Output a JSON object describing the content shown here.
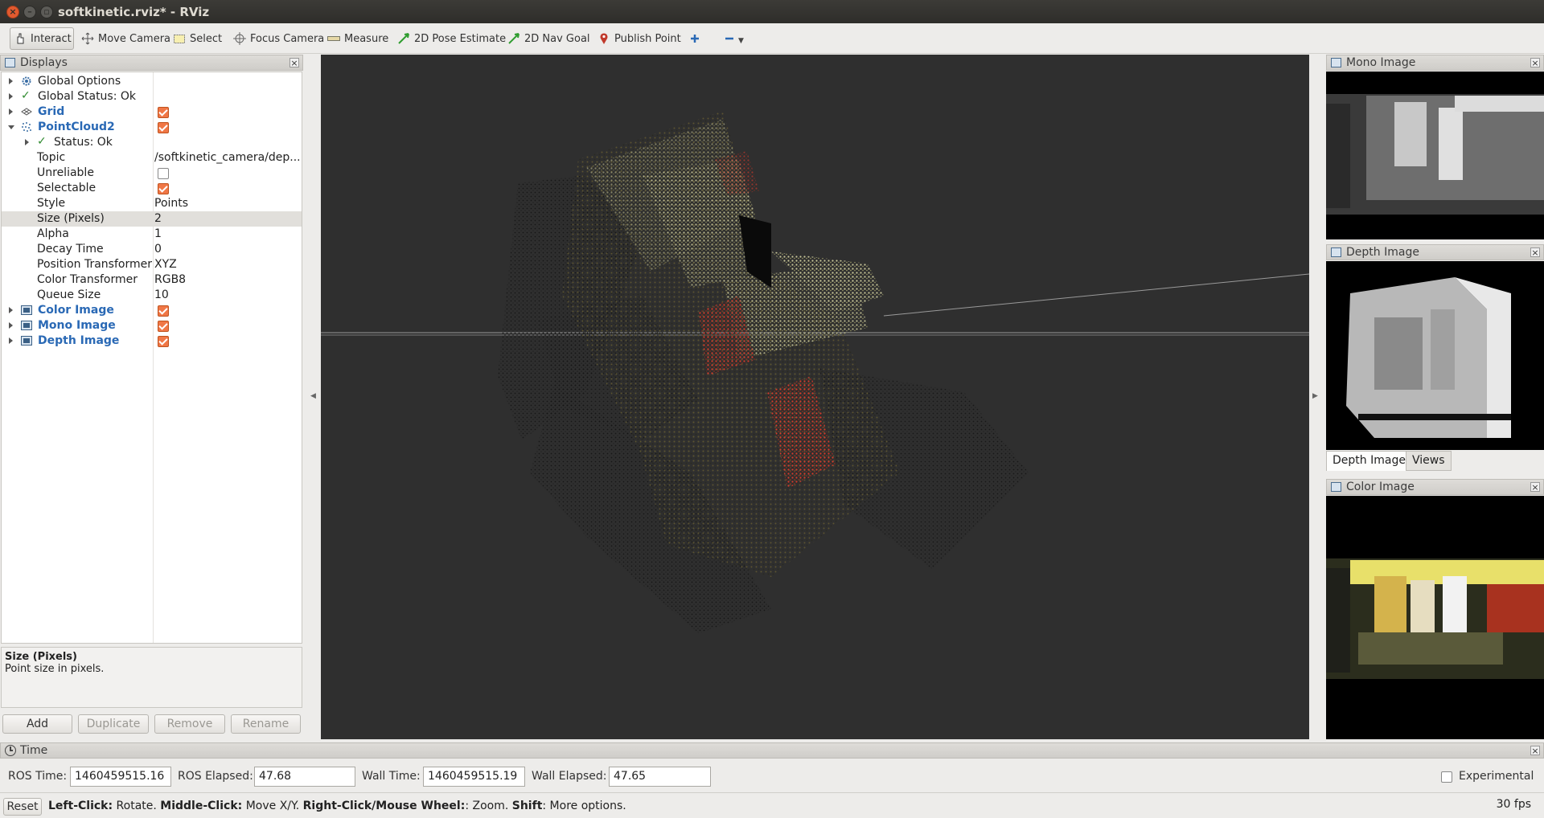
{
  "window": {
    "title": "softkinetic.rviz* - RViz"
  },
  "toolbar": {
    "interact": "Interact",
    "move_camera": "Move Camera",
    "select": "Select",
    "focus_camera": "Focus Camera",
    "measure": "Measure",
    "pose_estimate": "2D Pose Estimate",
    "nav_goal": "2D Nav Goal",
    "publish_point": "Publish Point"
  },
  "displays": {
    "title": "Displays",
    "rows": {
      "global_options": "Global Options",
      "global_status": "Global Status: Ok",
      "grid": "Grid",
      "pointcloud": "PointCloud2",
      "status": "Status: Ok",
      "topic_label": "Topic",
      "topic_value": "/softkinetic_camera/dep...",
      "unreliable_label": "Unreliable",
      "selectable_label": "Selectable",
      "style_label": "Style",
      "style_value": "Points",
      "size_label": "Size (Pixels)",
      "size_value": "2",
      "alpha_label": "Alpha",
      "alpha_value": "1",
      "decay_label": "Decay Time",
      "decay_value": "0",
      "pos_label": "Position Transformer",
      "pos_value": "XYZ",
      "color_label": "Color Transformer",
      "color_value": "RGB8",
      "queue_label": "Queue Size",
      "queue_value": "10",
      "color_image": "Color Image",
      "mono_image": "Mono Image",
      "depth_image": "Depth Image"
    },
    "checked": {
      "grid": true,
      "pointcloud": true,
      "unreliable": false,
      "selectable": true,
      "color_image": true,
      "mono_image": true,
      "depth_image": true
    },
    "description": {
      "title": "Size (Pixels)",
      "text": "Point size in pixels."
    },
    "buttons": {
      "add": "Add",
      "duplicate": "Duplicate",
      "remove": "Remove",
      "rename": "Rename"
    }
  },
  "panels": {
    "mono": "Mono Image",
    "depth": "Depth Image",
    "color": "Color Image",
    "tabs": [
      "Depth Image",
      "Views"
    ]
  },
  "time": {
    "title": "Time",
    "ros_time_label": "ROS Time:",
    "ros_time": "1460459515.16",
    "ros_elapsed_label": "ROS Elapsed:",
    "ros_elapsed": "47.68",
    "wall_time_label": "Wall Time:",
    "wall_time": "1460459515.19",
    "wall_elapsed_label": "Wall Elapsed:",
    "wall_elapsed": "47.65",
    "experimental": "Experimental"
  },
  "status": {
    "reset": "Reset",
    "hint_b1": "Left-Click:",
    "hint_t1": " Rotate. ",
    "hint_b2": "Middle-Click:",
    "hint_t2": " Move X/Y. ",
    "hint_b3": "Right-Click/Mouse Wheel:",
    "hint_t3": ": Zoom. ",
    "hint_b4": "Shift",
    "hint_t4": ": More options.",
    "fps": "30 fps"
  }
}
